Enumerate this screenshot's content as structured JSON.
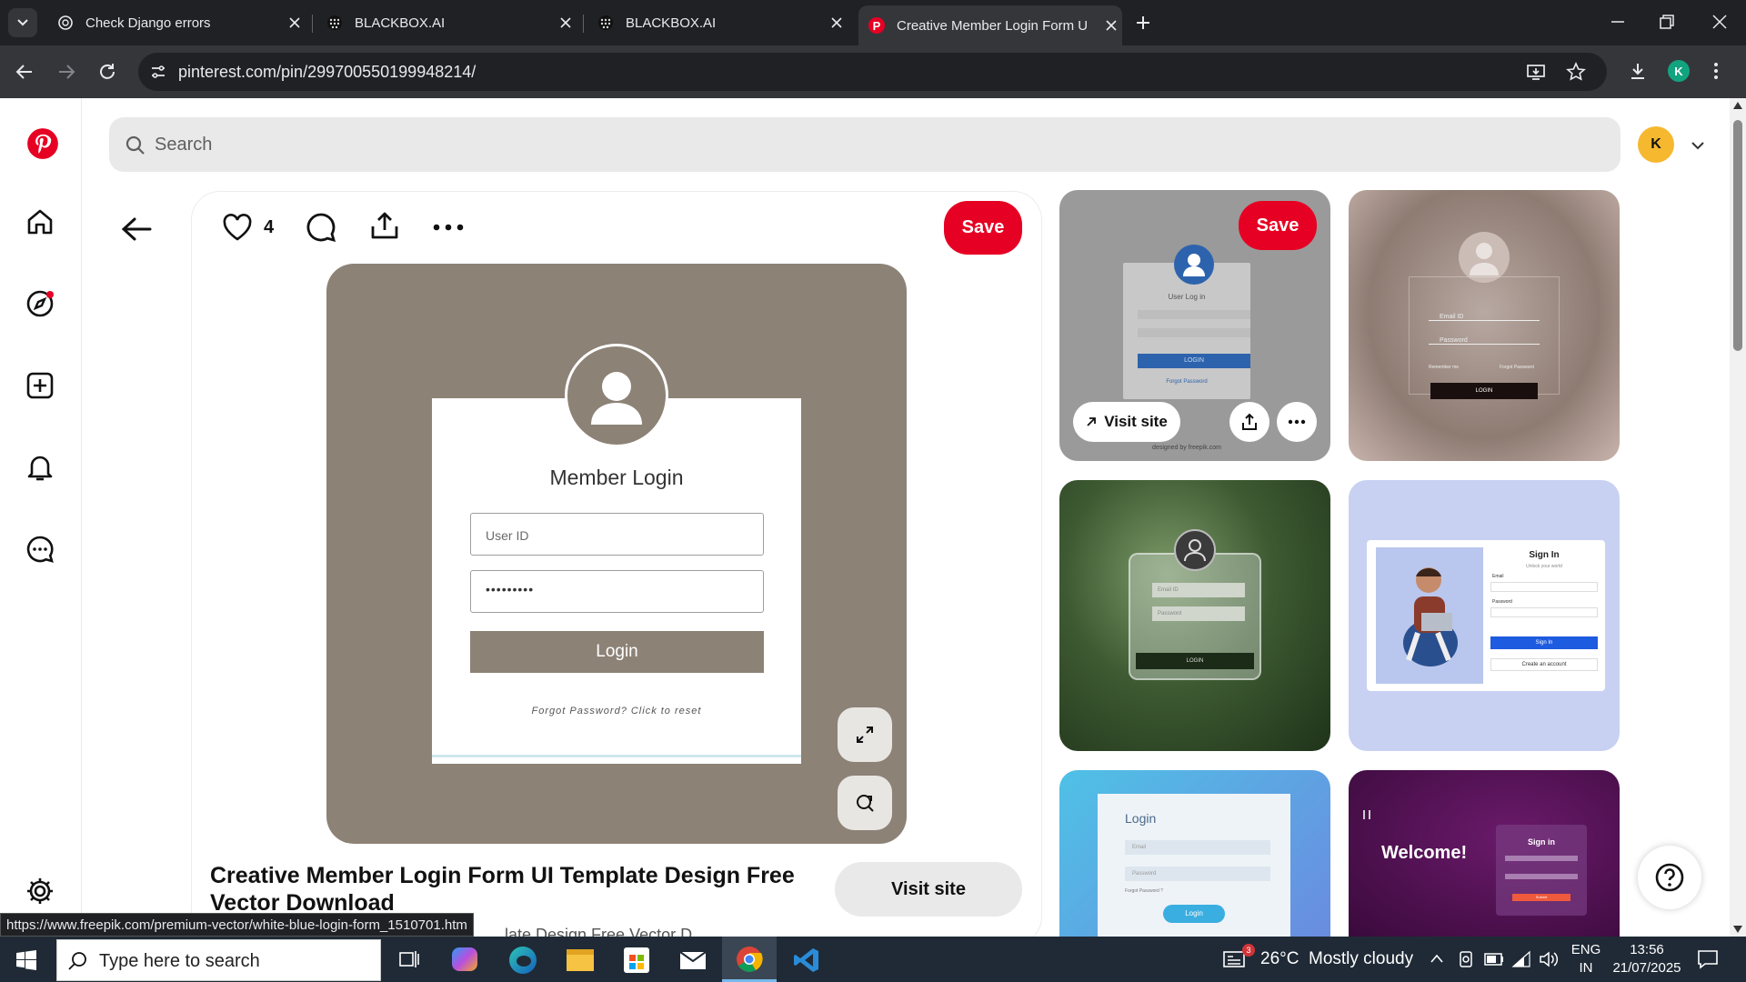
{
  "browser": {
    "tabs": [
      {
        "title": "Check Django errors",
        "icon": "chatgpt-icon"
      },
      {
        "title": "BLACKBOX.AI",
        "icon": "blackbox-icon"
      },
      {
        "title": "BLACKBOX.AI",
        "icon": "blackbox-icon"
      },
      {
        "title": "Creative Member Login Form U",
        "icon": "pinterest-icon",
        "active": true
      }
    ],
    "url": "pinterest.com/pin/299700550199948214/",
    "profile_initial": "K",
    "status_url": "https://www.freepik.com/premium-vector/white-blue-login-form_1510701.htm"
  },
  "pinterest": {
    "search_placeholder": "Search",
    "avatar_initial": "K",
    "like_count": "4",
    "save_label": "Save",
    "visit_site_label": "Visit site",
    "title": "Creative Member Login Form UI Template Design Free Vector Download",
    "subtitle_partial": "...late Design Free Vector D...",
    "pin_image": {
      "heading": "Member Login",
      "userid_placeholder": "User ID",
      "password_value": "•••••••••",
      "login_label": "Login",
      "forgot_text": "Forgot Password? Click to reset"
    },
    "thumbs": [
      {
        "save": "Save",
        "visit": "Visit site",
        "caption": "User Log in",
        "login": "LOGIN",
        "forgot": "Forgot Password",
        "credit": "designed by freepik.com"
      },
      {
        "field1": "Email ID",
        "field2": "Password",
        "remember": "Remember me",
        "forgot": "Forgot Password",
        "btn": "LOGIN"
      },
      {
        "field1": "Email ID",
        "field2": "Password",
        "btn": "LOGIN"
      },
      {
        "heading": "Sign In",
        "sub": "Unlock your world",
        "email": "Email",
        "password": "Password",
        "btn": "Sign In",
        "create": "Create an account"
      },
      {
        "heading": "Login",
        "email": "Email",
        "password": "Password",
        "forgot": "Forgot Password ?",
        "btn": "Login"
      },
      {
        "welcome": "Welcome!",
        "heading": "Sign in",
        "btn": "Submit"
      }
    ]
  },
  "taskbar": {
    "search_placeholder": "Type here to search",
    "weather_badge": "3",
    "weather": "26°C  Mostly cloudy",
    "lang1": "ENG",
    "lang2": "IN",
    "time": "13:56",
    "date": "21/07/2025"
  },
  "colors": {
    "pinterest_red": "#e60023",
    "pin_bg": "#8d8276",
    "taskbar": "#1f2a36"
  }
}
